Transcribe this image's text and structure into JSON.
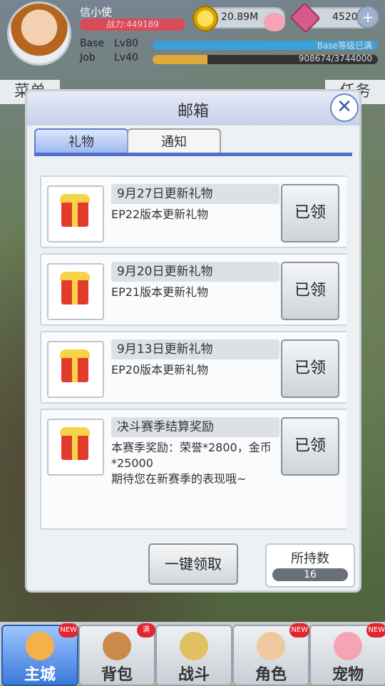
{
  "player": {
    "name": "信小使",
    "power": "战力:449189",
    "zeny": "20.89M",
    "gems": "4520",
    "base_label": "Base",
    "base_level": "Lv80",
    "base_status": "Base等级已满",
    "base_progress": 1.0,
    "job_label": "Job",
    "job_level": "Lv40",
    "job_exp": "908674/3744000",
    "job_progress": 0.243
  },
  "background_tabs": {
    "left": "菜单",
    "right": "任务"
  },
  "mailbox": {
    "title": "邮箱",
    "tabs": [
      {
        "label": "礼物",
        "active": true
      },
      {
        "label": "通知",
        "active": false
      }
    ],
    "mails": [
      {
        "title": "9月27日更新礼物",
        "body": "EP22版本更新礼物",
        "button": "已领"
      },
      {
        "title": "9月20日更新礼物",
        "body": "EP21版本更新礼物",
        "button": "已领"
      },
      {
        "title": "9月13日更新礼物",
        "body": "EP20版本更新礼物",
        "button": "已领"
      },
      {
        "title": "决斗赛季结算奖励",
        "body": "本赛季奖励：荣誉*2800，金币*25000\n期待您在新赛季的表现哦~",
        "button": "已领"
      }
    ],
    "claim_all": "一键领取",
    "held_label": "所持数",
    "held_count": "16"
  },
  "nav": [
    {
      "label": "主城",
      "badge": "NEW",
      "active": true,
      "icon_color": "#f5b04a"
    },
    {
      "label": "背包",
      "badge": "满",
      "active": false,
      "icon_color": "#c98a4a"
    },
    {
      "label": "战斗",
      "badge": "",
      "active": false,
      "icon_color": "#e0c060"
    },
    {
      "label": "角色",
      "badge": "NEW",
      "active": false,
      "icon_color": "#f0c8a0"
    },
    {
      "label": "宠物",
      "badge": "NEW",
      "active": false,
      "icon_color": "#f5a4b4"
    }
  ]
}
